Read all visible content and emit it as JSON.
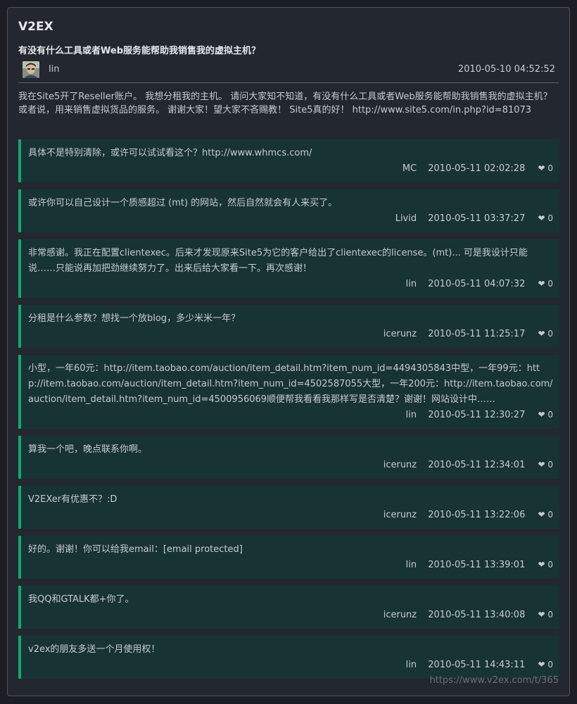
{
  "site": {
    "name": "V2EX"
  },
  "topic": {
    "title": "有没有什么工具或者Web服务能帮助我销售我的虚拟主机？",
    "author": "lin",
    "date": "2010-05-10 04:52:52",
    "avatar_icon": "user-avatar",
    "body": "我在Site5开了Reseller账户。 我想分租我的主机。 请问大家知不知道，有没有什么工具或者Web服务能帮助我销售我的虚拟主机？ 或者说，用来销售虚拟货品的服务。 谢谢大家！望大家不吝赐教！ Site5真的好！ http://www.site5.com/in.php?id=81073"
  },
  "replies": [
    {
      "content": "具体不是特别清除，或许可以试试看这个？http://www.whmcs.com/",
      "user": "MC",
      "time": "2010-05-11 02:02:28",
      "likes": "❤ 0"
    },
    {
      "content": "或许你可以自己设计一个质感超过 (mt) 的网站，然后自然就会有人来买了。",
      "user": "Livid",
      "time": "2010-05-11 03:37:27",
      "likes": "❤ 0"
    },
    {
      "content": "非常感谢。我正在配置clientexec。后来才发现原来Site5为它的客户给出了clientexec的license。(mt)... 可是我设计只能说……只能说再加把劲继续努力了。出来后给大家看一下。再次感谢！",
      "user": "lin",
      "time": "2010-05-11 04:07:32",
      "likes": "❤ 0"
    },
    {
      "content": "分租是什么参数？想找一个放blog，多少米米一年？",
      "user": "icerunz",
      "time": "2010-05-11 11:25:17",
      "likes": "❤ 0"
    },
    {
      "content": "小型，一年60元：http://item.taobao.com/auction/item_detail.htm?item_num_id=4494305843中型，一年99元：http://item.taobao.com/auction/item_detail.htm?item_num_id=4502587055大型，一年200元：http://item.taobao.com/auction/item_detail.htm?item_num_id=4500956069顺便帮我看看我那样写是否清楚？谢谢！网站设计中……",
      "user": "lin",
      "time": "2010-05-11 12:30:27",
      "likes": "❤ 0"
    },
    {
      "content": "算我一个吧，晚点联系你啊。",
      "user": "icerunz",
      "time": "2010-05-11 12:34:01",
      "likes": "❤ 0"
    },
    {
      "content": "V2EXer有优惠不？:D",
      "user": "icerunz",
      "time": "2010-05-11 13:22:06",
      "likes": "❤ 0"
    },
    {
      "content": "好的。谢谢！你可以给我email：[email protected]",
      "user": "lin",
      "time": "2010-05-11 13:39:01",
      "likes": "❤ 0"
    },
    {
      "content": "我QQ和GTALK都+你了。",
      "user": "icerunz",
      "time": "2010-05-11 13:40:08",
      "likes": "❤ 0"
    },
    {
      "content": "v2ex的朋友多送一个月使用权！",
      "user": "lin",
      "time": "2010-05-11 14:43:11",
      "likes": "❤ 0"
    }
  ],
  "footer": {
    "url": "https://www.v2ex.com/t/365"
  },
  "colors": {
    "accent": "#11a86b",
    "reply_bg": "#183334",
    "card_bg": "#23272f",
    "page_bg": "#1b1e25"
  }
}
